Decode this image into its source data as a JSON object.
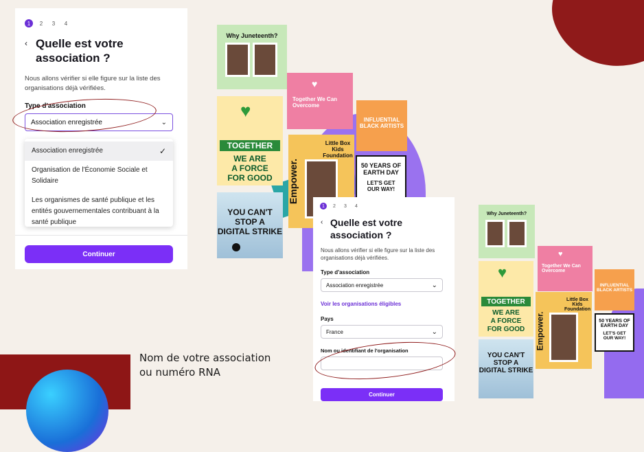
{
  "panel1": {
    "steps": [
      "1",
      "2",
      "3",
      "4"
    ],
    "back_icon": "chevron-left-icon",
    "title_line1": "Quelle est votre",
    "title_line2": "association ?",
    "desc_line1": "Nous allons vérifier si elle figure sur la liste des",
    "desc_line2": "organisations déjà vérifiées.",
    "type_label": "Type d'association",
    "type_value": "Association enregistrée",
    "dropdown": {
      "item1": "Association enregistrée",
      "item2_line1": "Organisation de l'Économie Sociale et",
      "item2_line2": "Solidaire",
      "item3_line1": "Les organismes de santé publique et les",
      "item3_line2": "entités gouvernementales contribuant à la",
      "item3_line3": "santé publique"
    },
    "continue": "Continuer"
  },
  "panel2": {
    "steps": [
      "1",
      "2",
      "3",
      "4"
    ],
    "title_line1": "Quelle est votre",
    "title_line2": "association ?",
    "desc_line1": "Nous allons vérifier si elle figure sur la liste des",
    "desc_line2": "organisations déjà vérifiées.",
    "type_label": "Type d'association",
    "type_value": "Association enregistrée",
    "link": "Voir les organisations éligibles",
    "country_label": "Pays",
    "country_value": "France",
    "name_label": "Nom ou identifiant de l'organisation",
    "continue": "Continuer"
  },
  "posters": {
    "juneteenth": "Why Juneteenth?",
    "together_we": "Together We Can Overcome",
    "influential": "INFLUENTIAL BLACK ARTISTS",
    "together": "TOGETHER",
    "we_are": "WE ARE",
    "a_force": "A FORCE",
    "for_good": "FOR GOOD",
    "little_box": "Little Box Kids Foundation",
    "empower": "Empower.",
    "earth_day_1": "50 YEARS OF",
    "earth_day_2": "EARTH DAY",
    "lets_get": "LET'S GET OUR WAY!",
    "cant_stop_1": "YOU CAN'T",
    "cant_stop_2": "STOP A",
    "cant_stop_3": "DIGITAL STRIKE"
  },
  "caption": {
    "line1": "Nom de votre association",
    "line2": "ou numéro RNA"
  },
  "colors": {
    "accent": "#7b2ff7",
    "annotation": "#8e1a1a"
  }
}
